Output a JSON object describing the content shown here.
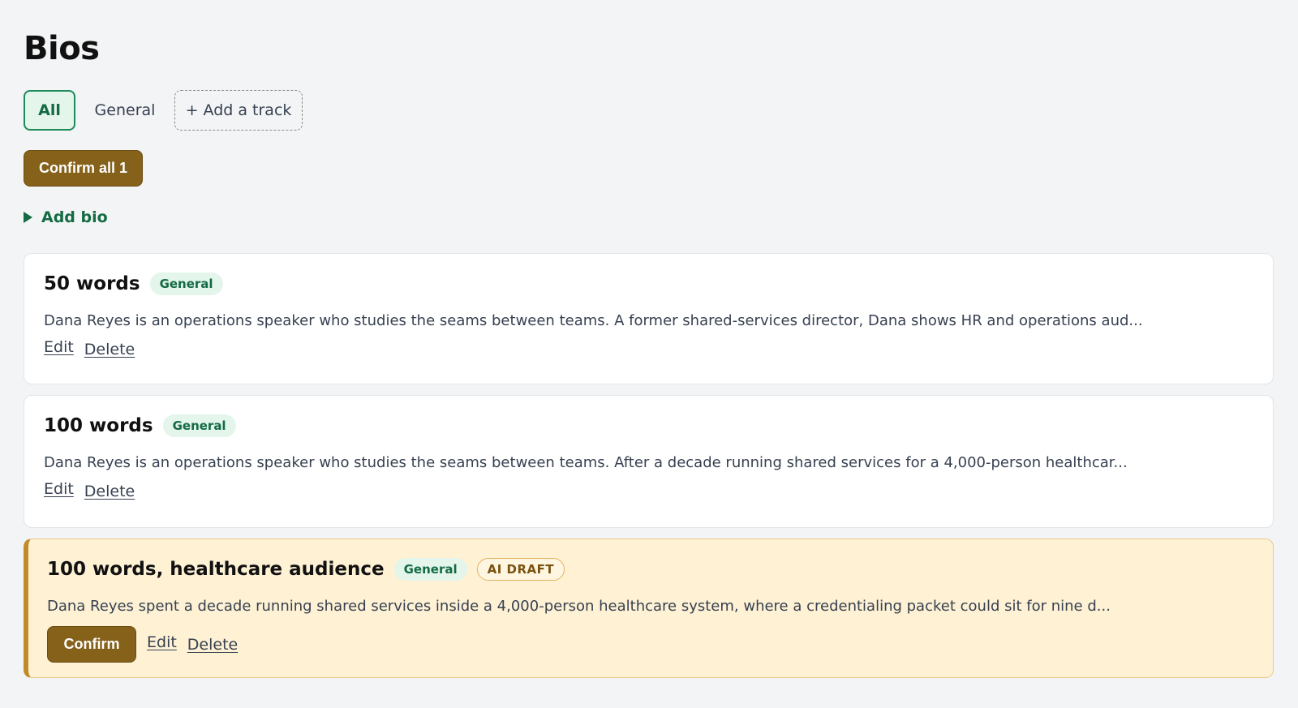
{
  "page": {
    "title": "Bios"
  },
  "tabs": {
    "all_label": "All",
    "general_label": "General",
    "add_track_label": "+ Add a track",
    "active": "All"
  },
  "toolbar": {
    "confirm_all_label": "Confirm all 1",
    "add_bio_label": "Add bio"
  },
  "bios": [
    {
      "title": "50 words",
      "tag": "General",
      "excerpt": "Dana Reyes is an operations speaker who studies the seams between teams. A former shared-services director, Dana shows HR and operations aud...",
      "edit_label": "Edit",
      "delete_label": "Delete"
    },
    {
      "title": "100 words",
      "tag": "General",
      "excerpt": "Dana Reyes is an operations speaker who studies the seams between teams. After a decade running shared services for a 4,000-person healthcar...",
      "edit_label": "Edit",
      "delete_label": "Delete"
    },
    {
      "title": "100 words, healthcare audience",
      "tag": "General",
      "badge": "AI DRAFT",
      "excerpt": "Dana Reyes spent a decade running shared services inside a 4,000-person healthcare system, where a credentialing packet could sit for nine d...",
      "confirm_label": "Confirm",
      "edit_label": "Edit",
      "delete_label": "Delete"
    }
  ],
  "colors": {
    "accent_green": "#146b43",
    "confirm_brown": "#86611a",
    "draft_background": "#fef1d4",
    "draft_border": "#c28a2a"
  },
  "icons": {
    "add_bio": "triangle-right-icon"
  }
}
